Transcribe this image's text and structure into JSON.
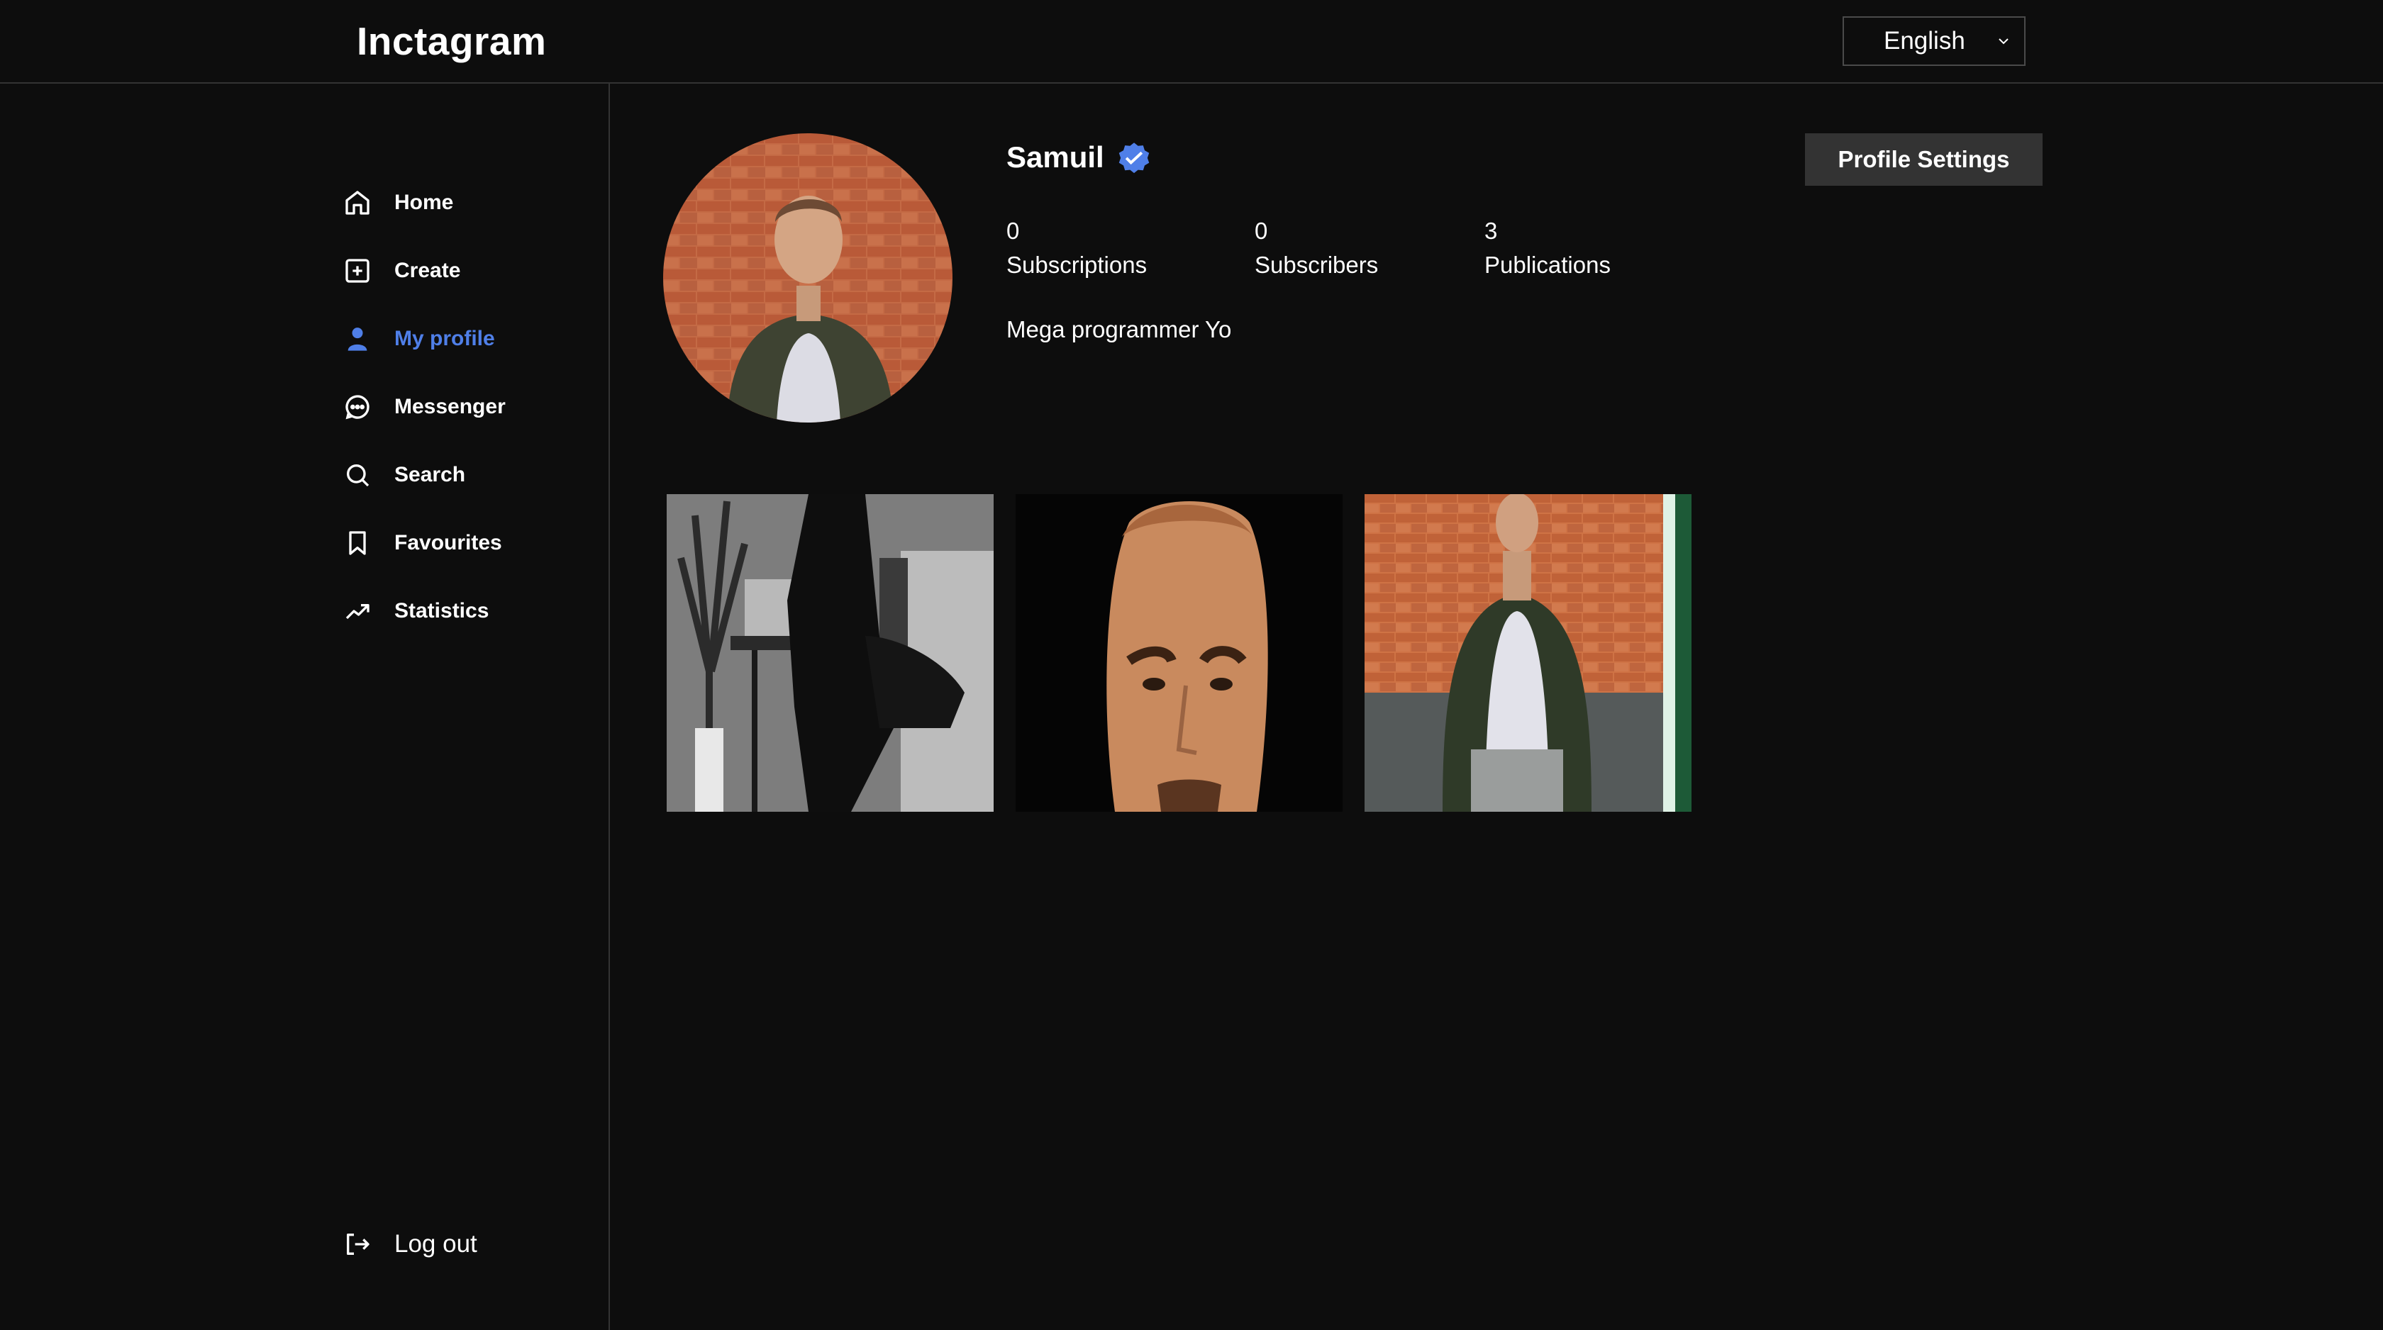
{
  "header": {
    "logo": "Inctagram",
    "language": {
      "selected": "English"
    }
  },
  "sidebar": {
    "items": [
      {
        "label": "Home",
        "icon": "home-icon"
      },
      {
        "label": "Create",
        "icon": "plus-square-icon"
      },
      {
        "label": "My profile",
        "icon": "person-icon",
        "active": true
      },
      {
        "label": "Messenger",
        "icon": "message-circle-icon"
      },
      {
        "label": "Search",
        "icon": "search-icon"
      },
      {
        "label": "Favourites",
        "icon": "bookmark-icon"
      },
      {
        "label": "Statistics",
        "icon": "trending-up-icon"
      }
    ],
    "logout": {
      "label": "Log out",
      "icon": "log-out-icon"
    }
  },
  "profile": {
    "username": "Samuil",
    "verified": true,
    "settings_label": "Profile Settings",
    "stats": [
      {
        "value": "0",
        "label": "Subscriptions"
      },
      {
        "value": "0",
        "label": "Subscribers"
      },
      {
        "value": "3",
        "label": "Publications"
      }
    ],
    "bio": "Mega programmer Yo"
  },
  "posts": [
    {
      "kind": "photo"
    },
    {
      "kind": "photo"
    },
    {
      "kind": "photo"
    }
  ],
  "colors": {
    "background": "#0d0d0d",
    "accent": "#4f7fe8",
    "button": "#333333",
    "divider": "#333333"
  }
}
